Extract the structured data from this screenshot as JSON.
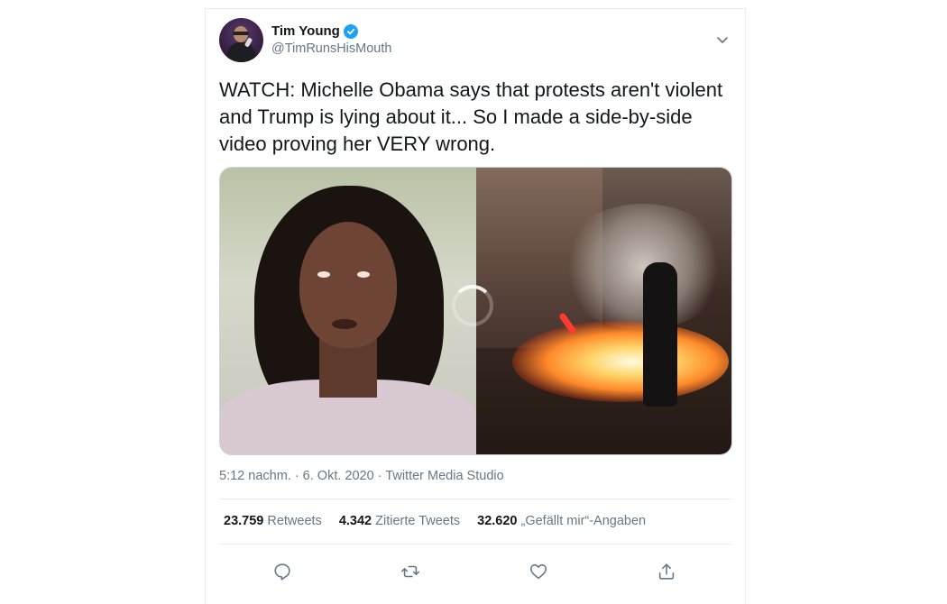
{
  "author": {
    "display_name": "Tim Young",
    "handle": "@TimRunsHisMouth",
    "verified": true
  },
  "tweet": {
    "text": "WATCH: Michelle Obama says that protests aren't violent and Trump is lying about it... So I made a side-by-side video proving her VERY wrong.",
    "media_type": "video",
    "media_state": "loading",
    "timestamp": "5:12 nachm. · 6. Okt. 2020 · Twitter Media Studio"
  },
  "stats": [
    {
      "count": "23.759",
      "label": "Retweets"
    },
    {
      "count": "4.342",
      "label": "Zitierte Tweets"
    },
    {
      "count": "32.620",
      "label": "„Gefällt mir“-Angaben"
    }
  ],
  "actions": {
    "reply": "reply-icon",
    "retweet": "retweet-icon",
    "like": "heart-icon",
    "share": "share-icon"
  },
  "colors": {
    "verified": "#1da1f2",
    "primary_text": "#14171a",
    "secondary_text": "#657786",
    "border": "#e6ecf0"
  }
}
